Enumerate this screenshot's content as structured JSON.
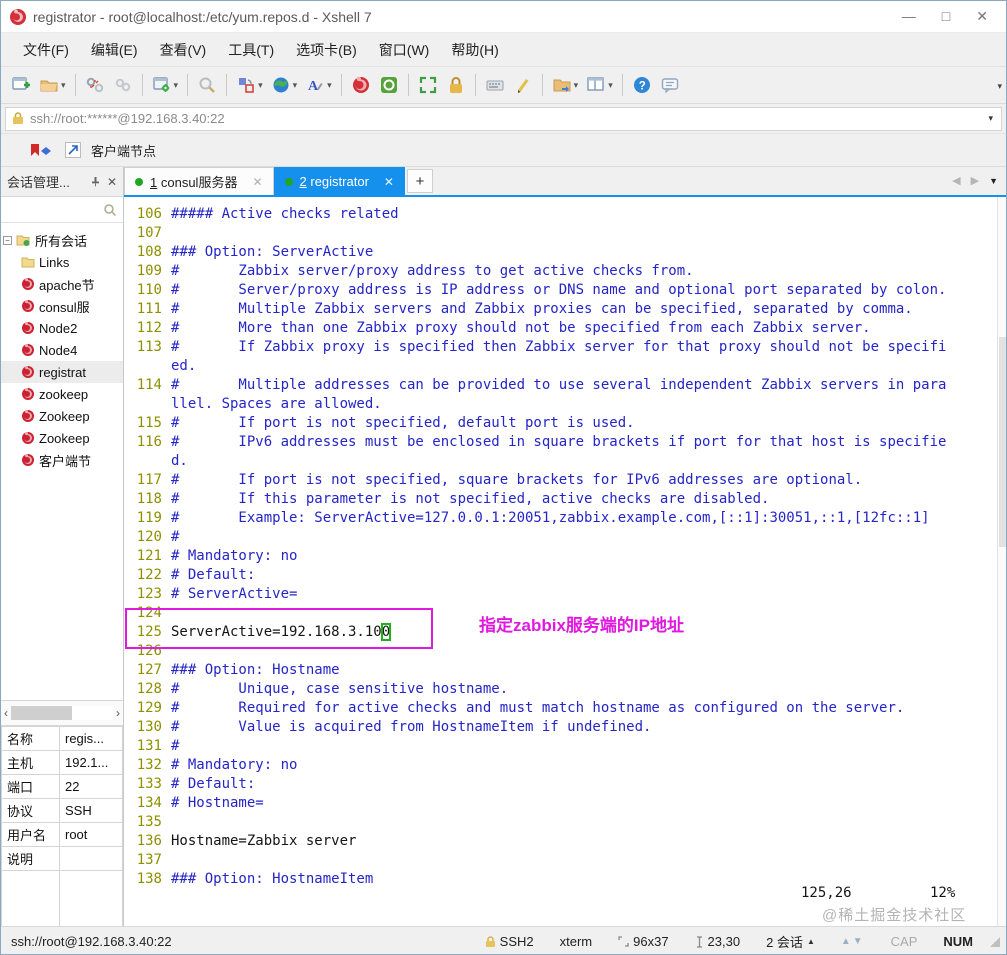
{
  "window": {
    "title": "registrator - root@localhost:/etc/yum.repos.d - Xshell 7",
    "controls": {
      "minimize": "—",
      "maximize": "□",
      "close": "✕"
    }
  },
  "menu": {
    "items": [
      "文件(F)",
      "编辑(E)",
      "查看(V)",
      "工具(T)",
      "选项卡(B)",
      "窗口(W)",
      "帮助(H)"
    ]
  },
  "toolbar": {
    "buttons": [
      {
        "name": "new-session-button",
        "icon": "new-session-icon",
        "dropdown": false
      },
      {
        "name": "open-session-button",
        "icon": "open-folder-icon",
        "dropdown": true
      },
      {
        "name": "separator"
      },
      {
        "name": "disconnect-button",
        "icon": "disconnect-icon",
        "dropdown": false
      },
      {
        "name": "reconnect-button",
        "icon": "reconnect-icon",
        "dropdown": false
      },
      {
        "name": "separator"
      },
      {
        "name": "session-properties-button",
        "icon": "properties-gear-icon",
        "dropdown": true
      },
      {
        "name": "separator"
      },
      {
        "name": "find-button",
        "icon": "search-icon",
        "dropdown": false
      },
      {
        "name": "separator"
      },
      {
        "name": "transfer-button",
        "icon": "transfer-icon",
        "dropdown": true
      },
      {
        "name": "encoding-button",
        "icon": "globe-icon",
        "dropdown": true
      },
      {
        "name": "font-button",
        "icon": "font-icon",
        "dropdown": true
      },
      {
        "name": "separator"
      },
      {
        "name": "xshell-button",
        "icon": "xshell-icon",
        "dropdown": false
      },
      {
        "name": "xftp-button",
        "icon": "xftp-icon",
        "dropdown": false
      },
      {
        "name": "separator"
      },
      {
        "name": "fullscreen-button",
        "icon": "fullscreen-icon",
        "dropdown": false
      },
      {
        "name": "lock-screen-button",
        "icon": "lock-icon",
        "dropdown": false
      },
      {
        "name": "separator"
      },
      {
        "name": "virtual-keyboard-button",
        "icon": "keyboard-icon",
        "dropdown": false
      },
      {
        "name": "compose-button",
        "icon": "compose-pen-icon",
        "dropdown": false
      },
      {
        "name": "separator"
      },
      {
        "name": "new-file-button",
        "icon": "folder-arrow-icon",
        "dropdown": true
      },
      {
        "name": "layout-button",
        "icon": "layout-icon",
        "dropdown": true
      },
      {
        "name": "separator"
      },
      {
        "name": "help-button",
        "icon": "help-icon",
        "dropdown": false
      },
      {
        "name": "feedback-button",
        "icon": "feedback-bubble-icon",
        "dropdown": false
      }
    ]
  },
  "address": {
    "url": "ssh://root:******@192.168.3.40:22"
  },
  "bookmarks": {
    "label": "客户端节点"
  },
  "tabs": {
    "items": [
      {
        "num": "1",
        "label": "consul服务器",
        "active": false,
        "close": "✕"
      },
      {
        "num": "2",
        "label": "registrator",
        "active": true,
        "close": "✕"
      }
    ],
    "new_tab": "+"
  },
  "sidebar": {
    "title": "会话管理...",
    "close": "✕",
    "tree": [
      {
        "label": "所有会话",
        "icon": "root-folder-icon",
        "root": true,
        "selected": false
      },
      {
        "label": "Links",
        "icon": "folder-icon",
        "root": false,
        "selected": false
      },
      {
        "label": "apache节",
        "icon": "session-icon",
        "root": false,
        "selected": false
      },
      {
        "label": "consul服",
        "icon": "session-icon",
        "root": false,
        "selected": false
      },
      {
        "label": "Node2",
        "icon": "session-icon",
        "root": false,
        "selected": false
      },
      {
        "label": "Node4",
        "icon": "session-icon",
        "root": false,
        "selected": false
      },
      {
        "label": "registrat",
        "icon": "session-icon",
        "root": false,
        "selected": true
      },
      {
        "label": "zookeep",
        "icon": "session-icon",
        "root": false,
        "selected": false
      },
      {
        "label": "Zookeep",
        "icon": "session-icon",
        "root": false,
        "selected": false
      },
      {
        "label": "Zookeep",
        "icon": "session-icon",
        "root": false,
        "selected": false
      },
      {
        "label": "客户端节",
        "icon": "session-icon",
        "root": false,
        "selected": false
      }
    ],
    "properties": [
      {
        "key": "名称",
        "value": "regis..."
      },
      {
        "key": "主机",
        "value": "192.1..."
      },
      {
        "key": "端口",
        "value": "22"
      },
      {
        "key": "协议",
        "value": "SSH"
      },
      {
        "key": "用户名",
        "value": "root"
      },
      {
        "key": "说明",
        "value": ""
      }
    ]
  },
  "terminal": {
    "rows": [
      {
        "n": "106",
        "t": "##### Active checks related",
        "c": "c"
      },
      {
        "n": "107",
        "t": "",
        "c": "c"
      },
      {
        "n": "108",
        "t": "### Option: ServerActive",
        "c": "c"
      },
      {
        "n": "109",
        "t": "#       Zabbix server/proxy address to get active checks from.",
        "c": "c"
      },
      {
        "n": "110",
        "t": "#       Server/proxy address is IP address or DNS name and optional port separated by colon.",
        "c": "c"
      },
      {
        "n": "111",
        "t": "#       Multiple Zabbix servers and Zabbix proxies can be specified, separated by comma.",
        "c": "c"
      },
      {
        "n": "112",
        "t": "#       More than one Zabbix proxy should not be specified from each Zabbix server.",
        "c": "c"
      },
      {
        "n": "113",
        "t": "#       If Zabbix proxy is specified then Zabbix server for that proxy should not be specifi",
        "c": "c"
      },
      {
        "n": "",
        "t": "ed.",
        "c": "c"
      },
      {
        "n": "114",
        "t": "#       Multiple addresses can be provided to use several independent Zabbix servers in para",
        "c": "c"
      },
      {
        "n": "",
        "t": "llel. Spaces are allowed.",
        "c": "c"
      },
      {
        "n": "115",
        "t": "#       If port is not specified, default port is used.",
        "c": "c"
      },
      {
        "n": "116",
        "t": "#       IPv6 addresses must be enclosed in square brackets if port for that host is specifie",
        "c": "c"
      },
      {
        "n": "",
        "t": "d.",
        "c": "c"
      },
      {
        "n": "117",
        "t": "#       If port is not specified, square brackets for IPv6 addresses are optional.",
        "c": "c"
      },
      {
        "n": "118",
        "t": "#       If this parameter is not specified, active checks are disabled.",
        "c": "c"
      },
      {
        "n": "119",
        "t": "#       Example: ServerActive=127.0.0.1:20051,zabbix.example.com,[::1]:30051,::1,[12fc::1]",
        "c": "c"
      },
      {
        "n": "120",
        "t": "#",
        "c": "c"
      },
      {
        "n": "121",
        "t": "# Mandatory: no",
        "c": "c"
      },
      {
        "n": "122",
        "t": "# Default:",
        "c": "c"
      },
      {
        "n": "123",
        "t": "# ServerActive=",
        "c": "c"
      },
      {
        "n": "124",
        "t": "",
        "c": "c"
      },
      {
        "n": "125",
        "t": "ServerActive=192.168.3.10",
        "c": "p",
        "cursor": "0"
      },
      {
        "n": "126",
        "t": "",
        "c": "c"
      },
      {
        "n": "127",
        "t": "### Option: Hostname",
        "c": "c"
      },
      {
        "n": "128",
        "t": "#       Unique, case sensitive hostname.",
        "c": "c"
      },
      {
        "n": "129",
        "t": "#       Required for active checks and must match hostname as configured on the server.",
        "c": "c"
      },
      {
        "n": "130",
        "t": "#       Value is acquired from HostnameItem if undefined.",
        "c": "c"
      },
      {
        "n": "131",
        "t": "#",
        "c": "c"
      },
      {
        "n": "132",
        "t": "# Mandatory: no",
        "c": "c"
      },
      {
        "n": "133",
        "t": "# Default:",
        "c": "c"
      },
      {
        "n": "134",
        "t": "# Hostname=",
        "c": "c"
      },
      {
        "n": "135",
        "t": "",
        "c": "c"
      },
      {
        "n": "136",
        "t": "Hostname=Zabbix server",
        "c": "p"
      },
      {
        "n": "137",
        "t": "",
        "c": "c"
      },
      {
        "n": "138",
        "t": "### Option: HostnameItem",
        "c": "c"
      }
    ],
    "annotation": "指定zabbix服务端的IP地址",
    "position": {
      "cursor": "125,26",
      "percent": "12%"
    },
    "watermark": "@稀土掘金技术社区"
  },
  "statusbar": {
    "left": "ssh://root@192.168.3.40:22",
    "protocol": "SSH2",
    "term_type": "xterm",
    "size": "96x37",
    "cursor_pos": "23,30",
    "sessions": "2 会话",
    "cap": "CAP",
    "num": "NUM"
  },
  "colors": {
    "accent_blue": "#1590ed",
    "comment_blue": "#2525c8",
    "line_number_olive": "#8f8f00",
    "highlight_magenta": "#e018e0",
    "cursor_green": "#1db31d",
    "session_icon_red": "#cc2233",
    "logo_red": "#d4303a"
  }
}
